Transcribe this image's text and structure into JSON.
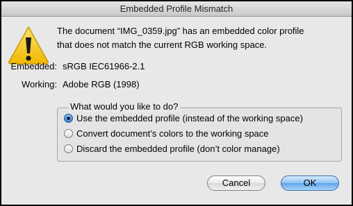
{
  "dialog": {
    "title": "Embedded Profile Mismatch",
    "message_line1": "The document “IMG_0359.jpg” has an embedded color profile",
    "message_line2": "that does not match the current RGB working space.",
    "embedded_label": "Embedded:",
    "embedded_value": "sRGB IEC61966-2.1",
    "working_label": "Working:",
    "working_value": "Adobe RGB (1998)"
  },
  "options": {
    "title": "What would you like to do?",
    "selected": "use_embedded",
    "use_embedded": "Use the embedded profile (instead of the working space)",
    "convert": "Convert document’s colors to the working space",
    "discard": "Discard the embedded profile (don’t color manage)"
  },
  "buttons": {
    "cancel": "Cancel",
    "ok": "OK"
  },
  "icons": {
    "warning": "warning-icon"
  },
  "colors": {
    "warning_yellow": "#f5c400",
    "default_button": "#6aaef0"
  }
}
